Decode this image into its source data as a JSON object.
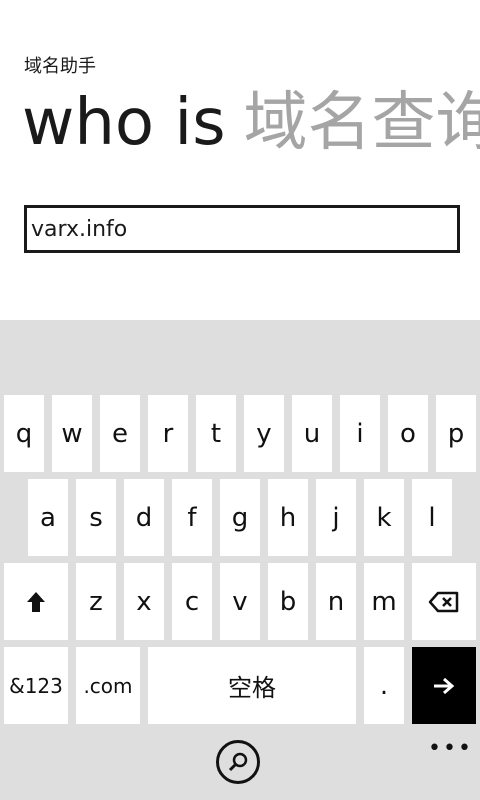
{
  "app": {
    "title": "域名助手"
  },
  "pivot": {
    "active": "who is",
    "next": "域名查询"
  },
  "domain_input": {
    "value": "varx.info"
  },
  "keyboard": {
    "row1": [
      "q",
      "w",
      "e",
      "r",
      "t",
      "y",
      "u",
      "i",
      "o",
      "p"
    ],
    "row2": [
      "a",
      "s",
      "d",
      "f",
      "g",
      "h",
      "j",
      "k",
      "l"
    ],
    "row3": [
      "z",
      "x",
      "c",
      "v",
      "b",
      "n",
      "m"
    ],
    "symbols_label": "&123",
    "dotcom_label": ".com",
    "space_label": "空格",
    "period_label": "."
  },
  "icons": {
    "shift": "shift-up-arrow",
    "backspace": "backspace",
    "enter": "right-arrow",
    "search": "magnifier",
    "more": "ellipsis"
  },
  "more_label": "•••"
}
